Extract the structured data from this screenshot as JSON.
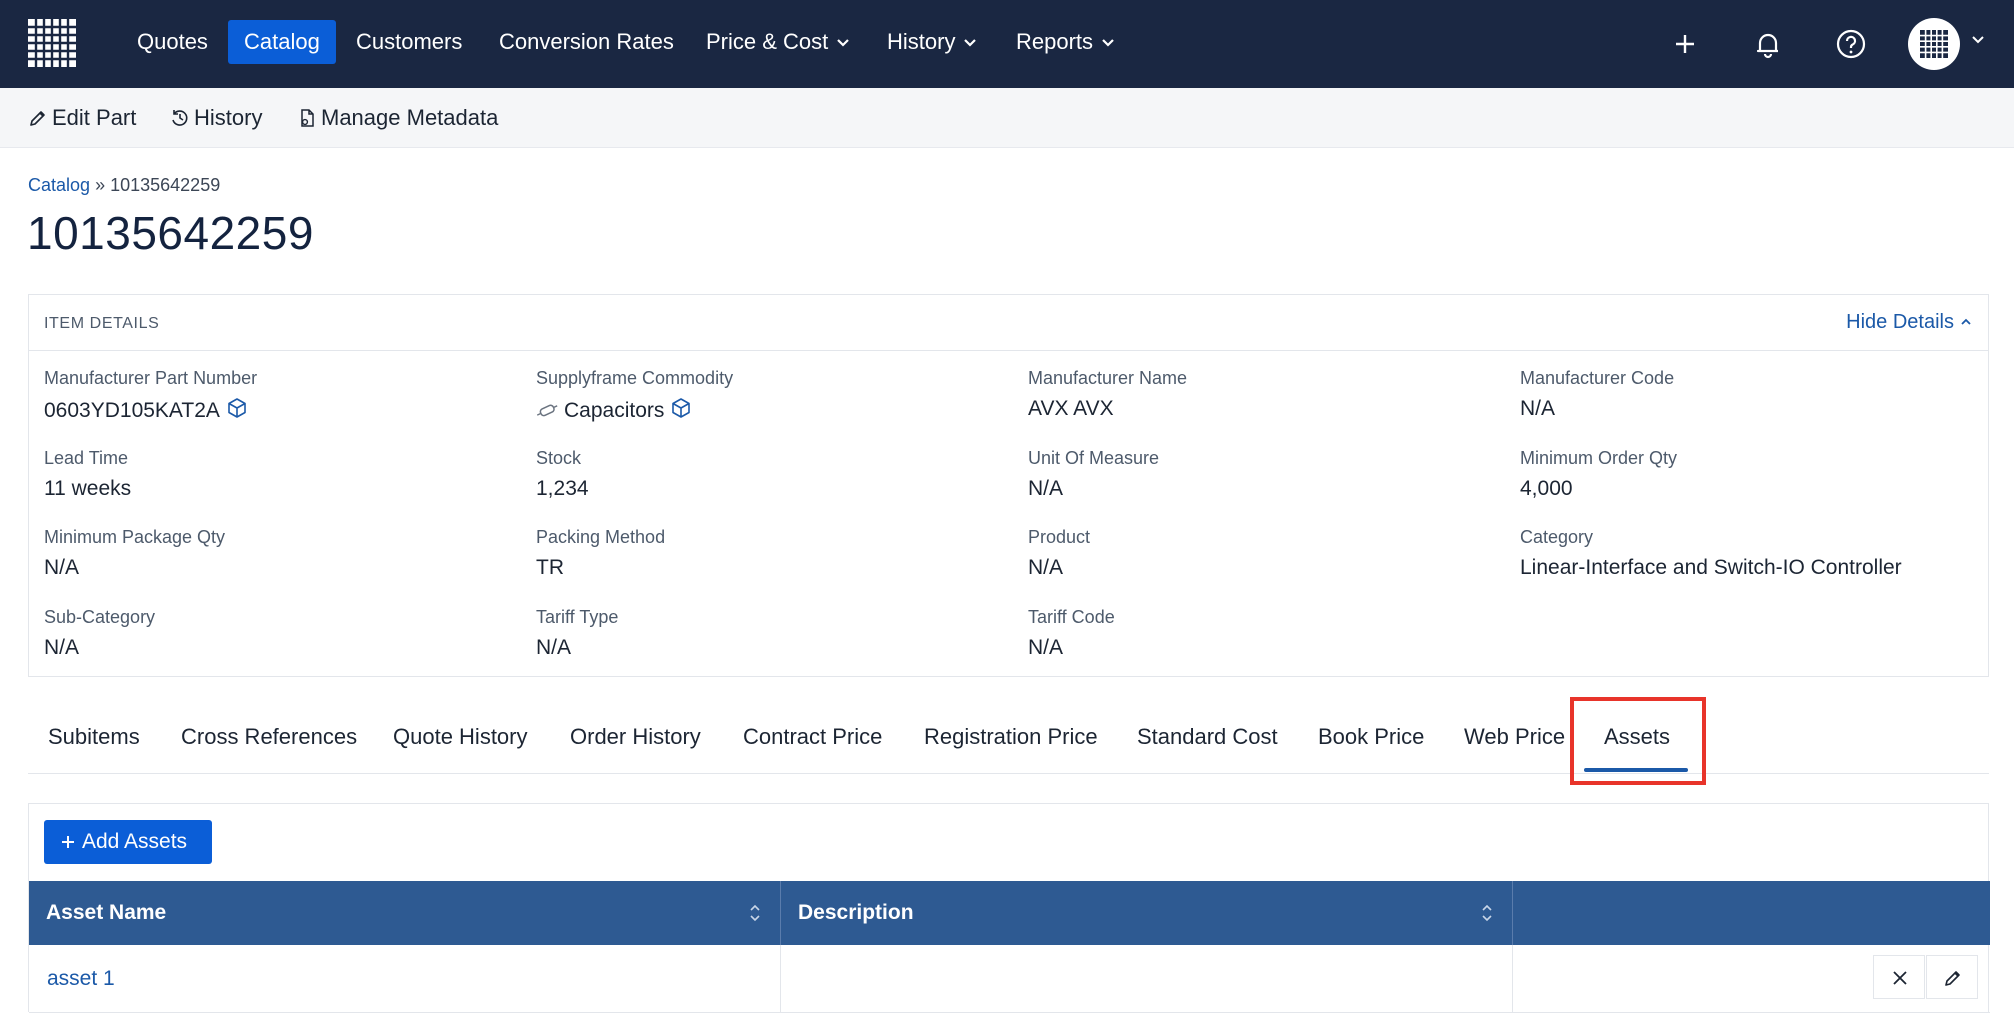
{
  "nav": {
    "items": [
      {
        "label": "Quotes",
        "active": false,
        "dropdown": false
      },
      {
        "label": "Catalog",
        "active": true,
        "dropdown": false
      },
      {
        "label": "Customers",
        "active": false,
        "dropdown": false
      },
      {
        "label": "Conversion Rates",
        "active": false,
        "dropdown": false
      },
      {
        "label": "Price & Cost",
        "active": false,
        "dropdown": true
      },
      {
        "label": "History",
        "active": false,
        "dropdown": true
      },
      {
        "label": "Reports",
        "active": false,
        "dropdown": true
      }
    ],
    "right_icons": [
      "plus-icon",
      "bell-icon",
      "help-icon"
    ],
    "avatar_icon": "grid-avatar-icon"
  },
  "toolbar": {
    "edit_label": "Edit Part",
    "history_label": "History",
    "metadata_label": "Manage Metadata"
  },
  "breadcrumb": {
    "root": "Catalog",
    "separator": "»",
    "current": "10135642259"
  },
  "page_title": "10135642259",
  "details": {
    "heading": "ITEM DETAILS",
    "toggle_label": "Hide Details",
    "fields": [
      {
        "label": "Manufacturer Part Number",
        "value": "0603YD105KAT2A"
      },
      {
        "label": "Supplyframe Commodity",
        "value": "Capacitors"
      },
      {
        "label": "Manufacturer Name",
        "value": "AVX AVX"
      },
      {
        "label": "Manufacturer Code",
        "value": "N/A"
      },
      {
        "label": "Lead Time",
        "value": "11 weeks"
      },
      {
        "label": "Stock",
        "value": "1,234"
      },
      {
        "label": "Unit Of Measure",
        "value": "N/A"
      },
      {
        "label": "Minimum Order Qty",
        "value": "4,000"
      },
      {
        "label": "Minimum Package Qty",
        "value": "N/A"
      },
      {
        "label": "Packing Method",
        "value": "TR"
      },
      {
        "label": "Product",
        "value": "N/A"
      },
      {
        "label": "Category",
        "value": "Linear-Interface and Switch-IO Controller"
      },
      {
        "label": "Sub-Category",
        "value": "N/A"
      },
      {
        "label": "Tariff Type",
        "value": "N/A"
      },
      {
        "label": "Tariff Code",
        "value": "N/A"
      }
    ]
  },
  "tabs": [
    {
      "label": "Subitems"
    },
    {
      "label": "Cross References"
    },
    {
      "label": "Quote History"
    },
    {
      "label": "Order History"
    },
    {
      "label": "Contract Price"
    },
    {
      "label": "Registration Price"
    },
    {
      "label": "Standard Cost"
    },
    {
      "label": "Book Price"
    },
    {
      "label": "Web Price"
    },
    {
      "label": "Assets",
      "active": true
    }
  ],
  "assets": {
    "add_label": "Add Assets",
    "columns": [
      "Asset Name",
      "Description",
      ""
    ],
    "rows": [
      {
        "name": "asset 1",
        "description": ""
      }
    ]
  },
  "colors": {
    "nav_bg": "#1a2742",
    "accent": "#0b5ed7",
    "link": "#1b59a8",
    "table_header": "#2e5a92",
    "highlight": "#e8342a"
  }
}
